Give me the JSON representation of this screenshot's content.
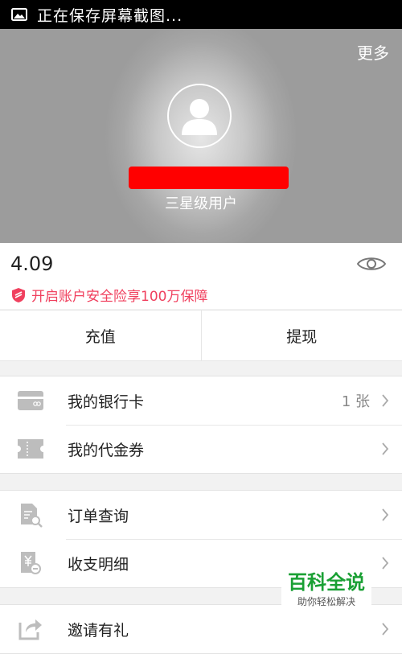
{
  "status_bar": {
    "text": "正在保存屏幕截图..."
  },
  "header": {
    "more_label": "更多",
    "user_level": "三星级用户"
  },
  "balance": {
    "amount": "4.09",
    "security_text": "开启账户安全险享100万保障"
  },
  "actions": {
    "recharge": "充值",
    "withdraw": "提现"
  },
  "menu": {
    "bank_card": {
      "label": "我的银行卡",
      "count": "1 张"
    },
    "voucher": {
      "label": "我的代金券"
    },
    "orders": {
      "label": "订单查询"
    },
    "details": {
      "label": "收支明细"
    },
    "invite": {
      "label": "邀请有礼"
    }
  },
  "watermark": {
    "title": "百科全说",
    "subtitle": "助你轻松解决"
  },
  "colors": {
    "accent": "#f0405e",
    "icon_gray": "#bdbdbd",
    "header_gray": "#a6a6a6"
  }
}
